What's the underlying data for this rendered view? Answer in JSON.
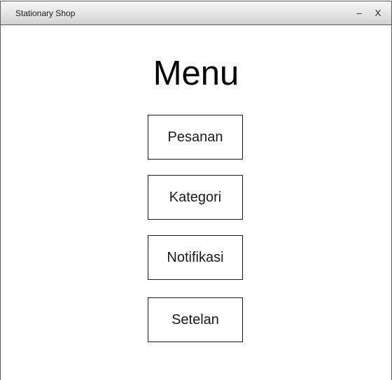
{
  "window": {
    "title": "Stationary Shop",
    "minimize_label": "–",
    "close_label": "X"
  },
  "main": {
    "heading": "Menu",
    "buttons": [
      {
        "label": "Pesanan"
      },
      {
        "label": "Kategori"
      },
      {
        "label": "Notifikasi"
      },
      {
        "label": "Setelan"
      }
    ]
  }
}
